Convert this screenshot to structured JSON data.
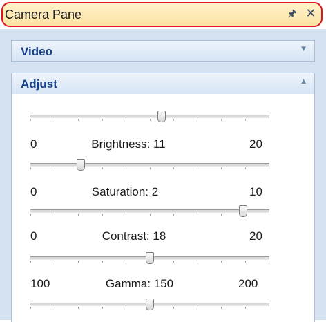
{
  "pane": {
    "title": "Camera Pane",
    "pin_icon": "pin-icon",
    "close_icon": "close-icon"
  },
  "groups": {
    "video": {
      "label": "Video",
      "expanded": false
    },
    "adjust": {
      "label": "Adjust",
      "expanded": true
    }
  },
  "sliders": {
    "top": {
      "fraction": 0.55
    },
    "brightness": {
      "name": "Brightness",
      "value": "11",
      "min": "0",
      "max": "20",
      "label_text": "Brightness: 11",
      "fraction": 0.55
    },
    "saturation": {
      "name": "Saturation",
      "value": "2",
      "min": "0",
      "max": "10",
      "label_text": "Saturation: 2",
      "fraction": 0.2
    },
    "contrast": {
      "name": "Contrast",
      "value": "18",
      "min": "0",
      "max": "20",
      "label_text": "Contrast: 18",
      "fraction": 0.9
    },
    "gamma": {
      "name": "Gamma",
      "value": "150",
      "min": "100",
      "max": "200",
      "label_text": "Gamma: 150",
      "fraction": 0.5
    },
    "bottom": {
      "fraction": 0.5
    }
  },
  "colors": {
    "highlight_border": "#e0151f",
    "title_bg": "#fbe3a4",
    "group_text": "#15428b",
    "panel_bg": "#d5e2f1"
  }
}
